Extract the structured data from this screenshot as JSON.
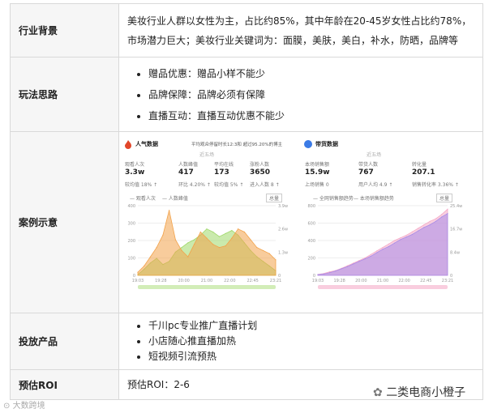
{
  "rows": [
    {
      "label": "行业背景",
      "lines": [
        "美妆行业人群以女性为主，占比约85%，其中年龄在20-45岁女性占比约78%，",
        "市场潜力巨大；美妆行业关键词为：面膜，美肤，美白，补水，防晒，品牌等"
      ]
    },
    {
      "label": "玩法思路",
      "bullets": [
        "赠品优惠：赠品小样不能少",
        "品牌保障：品牌必须有保障",
        "直播互动：直播互动优惠不能少"
      ]
    },
    {
      "label": "案例示意"
    },
    {
      "label": "投放产品",
      "bullets": [
        "千川pc专业推广直播计划",
        "小店随心推直播加热",
        "短视频引流预热"
      ]
    },
    {
      "label": "预估ROI",
      "value": "预估ROI：2-6"
    }
  ],
  "left_panel": {
    "title": "人气数据",
    "note": "平均观众停留时长12:3和 超过95.20%的博主",
    "tab": "近五场",
    "stats": [
      {
        "label": "观看人次",
        "value": "3.3w",
        "sub": "较均值 18% ↑"
      },
      {
        "label": "人数峰值",
        "value": "417",
        "sub": "环比 4.20% ↑"
      },
      {
        "label": "平均在线",
        "value": "173",
        "sub": "较均值 5% ↑"
      },
      {
        "label": "涨粉人数",
        "value": "3650",
        "sub": "进入人数 8 ↑"
      }
    ],
    "legend": [
      "观看人次",
      "人数峰值"
    ],
    "y_left": [
      "400",
      "300",
      "200",
      "100",
      "0"
    ],
    "y_right": [
      "3.9w",
      "2.6w",
      "1.3w",
      "0"
    ],
    "x": [
      "19:03",
      "19:28",
      "20:00",
      "21:00",
      "22:00",
      "22:45",
      "23:21"
    ],
    "btn": "总量"
  },
  "right_panel": {
    "title": "带货数据",
    "tab": "近五场",
    "stats": [
      {
        "label": "本场销售额",
        "value": "15.9w",
        "sub": "上场销售 0"
      },
      {
        "label": "带货人数",
        "value": "767",
        "sub": "用户人均 4.9 ↑"
      },
      {
        "label": "转化量",
        "value": "207.1",
        "sub": "销售转化率 3.36% ↑"
      }
    ],
    "legend": [
      "全网销售额趋势",
      "本场销售额趋势"
    ],
    "y_left": [
      "800",
      "600",
      "400",
      "200",
      "0"
    ],
    "y_right": [
      "25.4w",
      "16.7w",
      "8.4w",
      "0"
    ],
    "x": [
      "19:03",
      "19:28",
      "20:00",
      "21:00",
      "22:00",
      "22:45",
      "23:21"
    ],
    "btn": "总量"
  },
  "chart_data": [
    {
      "type": "area",
      "title": "人气数据",
      "series": [
        {
          "name": "观看人次",
          "values": [
            5,
            40,
            80,
            110,
            70,
            90,
            150,
            180,
            210,
            230,
            260,
            300,
            280,
            250,
            270,
            290,
            260,
            210,
            160,
            120,
            90,
            60,
            30
          ]
        },
        {
          "name": "人数峰值",
          "values": [
            20,
            60,
            120,
            180,
            260,
            420,
            230,
            160,
            120,
            200,
            280,
            240,
            200,
            180,
            190,
            240,
            300,
            280,
            230,
            180,
            160,
            140,
            100
          ]
        }
      ]
    },
    {
      "type": "area",
      "title": "带货数据",
      "series": [
        {
          "name": "全网销售额趋势",
          "values": [
            10,
            20,
            40,
            55,
            80,
            110,
            140,
            170,
            200,
            240,
            280,
            320,
            360,
            400,
            430,
            460,
            500,
            540,
            580,
            620,
            650,
            700,
            760
          ]
        },
        {
          "name": "本场销售额趋势",
          "values": [
            8,
            15,
            30,
            50,
            75,
            100,
            130,
            160,
            190,
            220,
            260,
            300,
            330,
            370,
            410,
            440,
            470,
            510,
            550,
            580,
            620,
            670,
            710
          ]
        }
      ]
    }
  ],
  "watermark_left": "大数跨境",
  "watermark_right": "二类电商小橙子",
  "colors": {
    "green": "#9fd86a",
    "orange": "#f2a24a",
    "pink": "#f4a9c7",
    "purple": "#a98be8",
    "red": "#e2472b",
    "blue": "#3b7be6"
  }
}
